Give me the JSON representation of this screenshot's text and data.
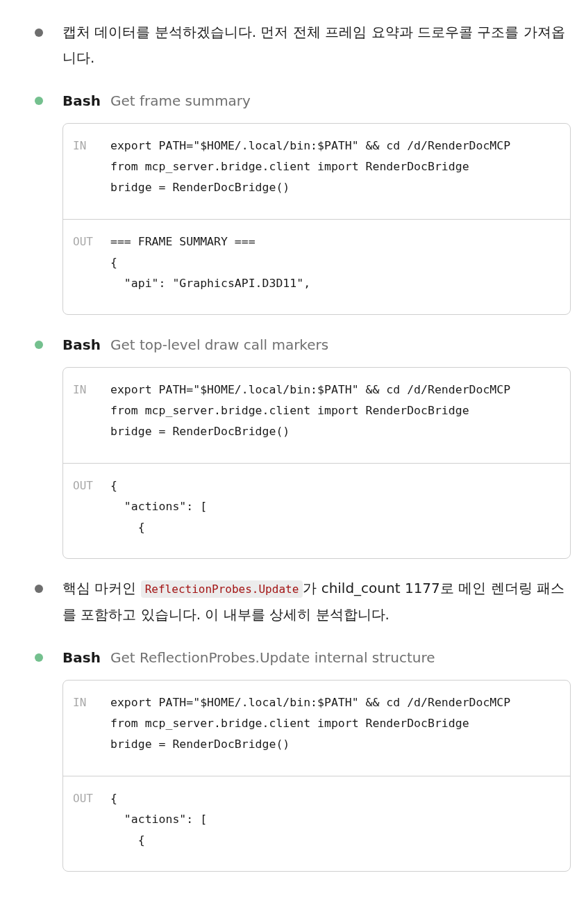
{
  "entries": [
    {
      "kind": "message",
      "segments": [
        {
          "kind": "text",
          "text": "캡처 데이터를 분석하겠습니다. 먼저 전체 프레임 요약과 드로우콜 구조를 가져옵니다."
        }
      ]
    },
    {
      "kind": "tool",
      "tool": "Bash",
      "description": "Get frame summary",
      "sections": [
        {
          "label": "IN",
          "lines": [
            "export PATH=\"$HOME/.local/bin:$PATH\" && cd /d/RenderDocMCP",
            "from mcp_server.bridge.client import RenderDocBridge",
            "bridge = RenderDocBridge()"
          ]
        },
        {
          "label": "OUT",
          "lines": [
            "=== FRAME SUMMARY ===",
            "{",
            "  \"api\": \"GraphicsAPI.D3D11\","
          ]
        }
      ]
    },
    {
      "kind": "tool",
      "tool": "Bash",
      "description": "Get top-level draw call markers",
      "sections": [
        {
          "label": "IN",
          "lines": [
            "export PATH=\"$HOME/.local/bin:$PATH\" && cd /d/RenderDocMCP",
            "from mcp_server.bridge.client import RenderDocBridge",
            "bridge = RenderDocBridge()"
          ]
        },
        {
          "label": "OUT",
          "lines": [
            "{",
            "  \"actions\": [",
            "    {"
          ]
        }
      ]
    },
    {
      "kind": "message",
      "segments": [
        {
          "kind": "text",
          "text": "핵심 마커인 "
        },
        {
          "kind": "code",
          "text": "ReflectionProbes.Update"
        },
        {
          "kind": "text",
          "text": "가 child_count 1177로 메인 렌더링 패스를 포함하고 있습니다. 이 내부를 상세히 분석합니다."
        }
      ]
    },
    {
      "kind": "tool",
      "tool": "Bash",
      "description": "Get ReflectionProbes.Update internal structure",
      "sections": [
        {
          "label": "IN",
          "lines": [
            "export PATH=\"$HOME/.local/bin:$PATH\" && cd /d/RenderDocMCP",
            "from mcp_server.bridge.client import RenderDocBridge",
            "bridge = RenderDocBridge()"
          ]
        },
        {
          "label": "OUT",
          "lines": [
            "{",
            "  \"actions\": [",
            "    {"
          ]
        }
      ]
    }
  ]
}
